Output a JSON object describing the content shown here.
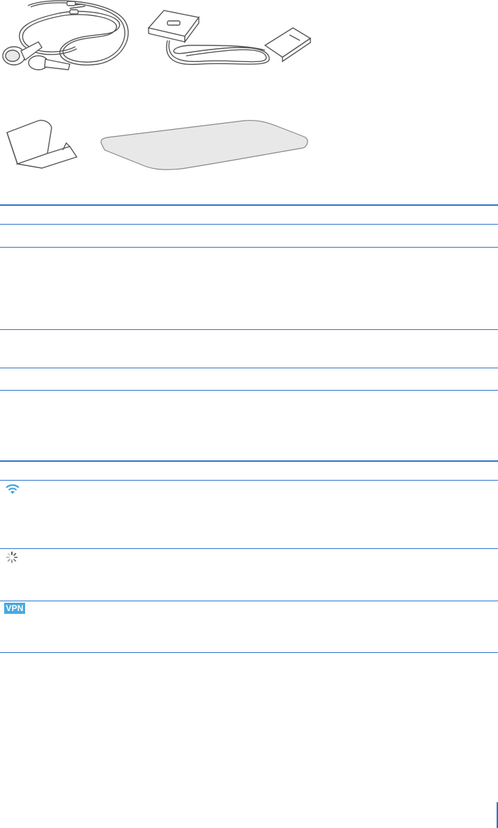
{
  "illustrations": [
    {
      "name": "earphones",
      "icon": "earphones-icon"
    },
    {
      "name": "dock-connector-to-usb-cable",
      "icon": "usb-cable-icon"
    },
    {
      "name": "stand",
      "icon": "stand-icon"
    },
    {
      "name": "polishing-cloth",
      "icon": "cloth-icon"
    }
  ],
  "status_icons": [
    {
      "icon": "wifi-icon",
      "color": "#3aa5e0"
    },
    {
      "icon": "activity-spinner-icon",
      "color": "#444444"
    },
    {
      "icon": "vpn-icon",
      "label": "VPN",
      "color": "#49a9de"
    }
  ],
  "colors": {
    "rule": "#2f73c8",
    "illustration_stroke": "#555555"
  }
}
